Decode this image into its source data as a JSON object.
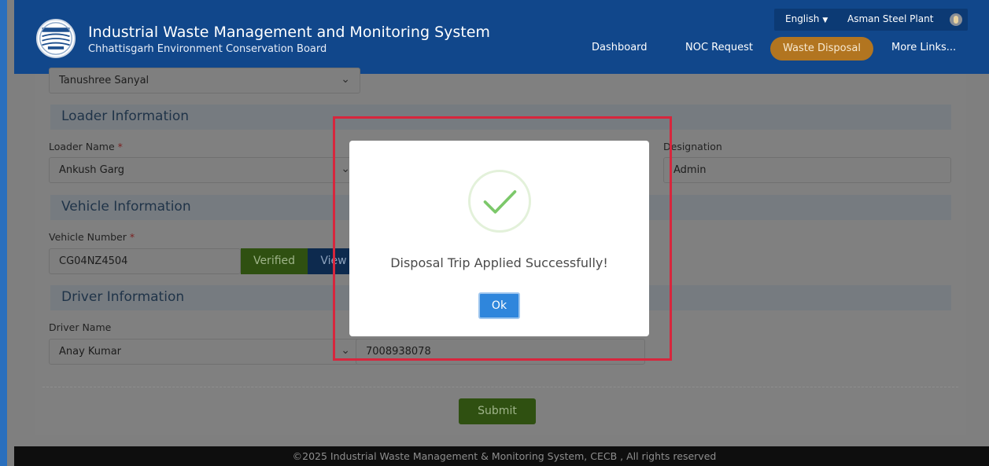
{
  "header": {
    "title": "Industrial Waste Management and Monitoring System",
    "subtitle": "Chhattisgarh Environment Conservation Board",
    "language": "English",
    "plant_name": "Asman Steel Plant",
    "nav": [
      {
        "label": "Dashboard"
      },
      {
        "label": "NOC Request"
      },
      {
        "label": "Waste Disposal"
      },
      {
        "label": "More Links..."
      }
    ]
  },
  "form": {
    "top_dropdown_value": "Tanushree Sanyal",
    "loader_section": "Loader Information",
    "loader_name_label": "Loader Name",
    "loader_name_value": "Ankush Garg",
    "designation_label": "Designation",
    "designation_value": "Admin",
    "vehicle_section": "Vehicle Information",
    "vehicle_number_label": "Vehicle Number",
    "vehicle_number_value": "CG04NZ4504",
    "verified_label": "Verified",
    "view_label": "View",
    "driver_section": "Driver Information",
    "driver_name_label": "Driver Name",
    "driver_name_value": "Anay Kumar",
    "driver_phone_value": "7008938078",
    "required_mark": "*",
    "submit_label": "Submit"
  },
  "modal": {
    "message": "Disposal Trip Applied Successfully!",
    "ok_label": "Ok"
  },
  "footer": {
    "text": "©2025 Industrial Waste Management & Monitoring System, CECB , All rights reserved"
  },
  "colors": {
    "header_bg": "#11478b",
    "active_nav": "#b27520",
    "highlight": "#d7263d",
    "ok_button": "#2f86dc",
    "success_check": "#7cc86a"
  }
}
